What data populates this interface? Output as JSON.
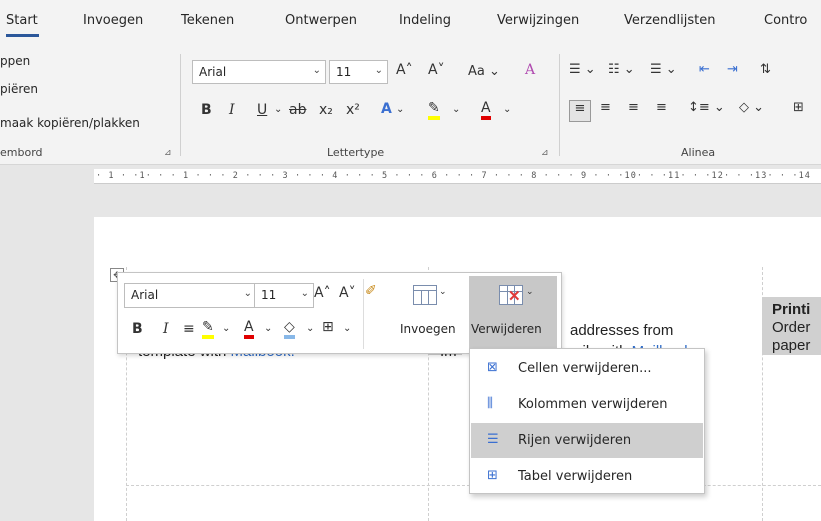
{
  "ribbon_tabs": [
    "Start",
    "Invoegen",
    "Tekenen",
    "Ontwerpen",
    "Indeling",
    "Verwijzingen",
    "Verzendlijsten",
    "Contro"
  ],
  "clipboard": {
    "cut_label": "ppen",
    "copy_label": "piëren",
    "format_painter_label": "maak kopiëren/plakken",
    "group_label": "embord"
  },
  "font_group": {
    "font_name": "Arial",
    "font_size": "11",
    "group_label": "Lettertype",
    "bold": "B",
    "italic": "I",
    "underline": "U",
    "strike": "ab",
    "subscript": "x₂",
    "superscript": "x²",
    "grow": "A˄",
    "shrink": "A˅",
    "case": "Aa",
    "text_effects": "A",
    "highlight": "𝓀",
    "font_color": "A"
  },
  "paragraph_group": {
    "group_label": "Alinea"
  },
  "ruler": {
    "text": "· 1 · ·1· · · 1 · · · 2 · · · 3 · · · 4 · · · 5 · · · 6 · · · 7 · · · 8 · · · 9 · · ·10· · ·11· · ·12· · ·13· · ·14"
  },
  "document": {
    "cell1_text": "template with ",
    "cell1_link": "Mailbook.",
    "cell2_prefix": "Im",
    "cell2_text": "addresses from",
    "cell2_line2_prefix": "mily with ",
    "cell2_link": "Mailbook.",
    "cell3_bold": "Printi",
    "cell3_line2": "Order",
    "cell3_line3": "paper"
  },
  "mini_toolbar": {
    "font_name": "Arial",
    "font_size": "11",
    "grow": "A˄",
    "shrink": "A˅",
    "bold": "B",
    "italic": "I",
    "insert_label": "Invoegen",
    "delete_label": "Verwijderen"
  },
  "delete_menu": [
    {
      "label": "Cellen verwijderen...",
      "icon": "delete-cells-icon"
    },
    {
      "label": "Kolommen verwijderen",
      "icon": "delete-columns-icon"
    },
    {
      "label": "Rijen verwijderen",
      "icon": "delete-rows-icon"
    },
    {
      "label": "Tabel verwijderen",
      "icon": "delete-table-icon"
    }
  ],
  "colors": {
    "accent": "#2b579a",
    "highlight": "#ffff00",
    "font_color": "#e00000",
    "delete_x": "#e03a3a",
    "link": "#2f6cc7"
  }
}
